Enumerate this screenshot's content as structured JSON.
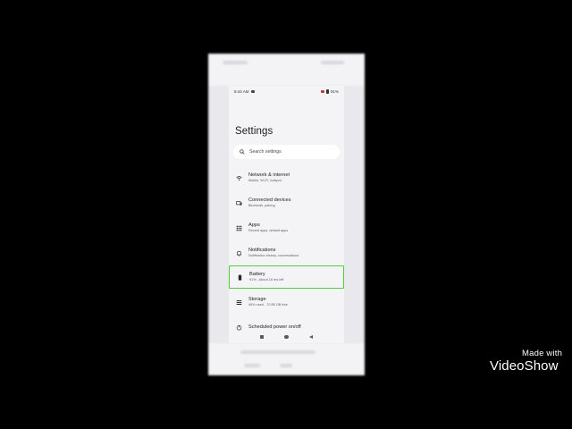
{
  "status_bar": {
    "time": "8:44 AM",
    "battery": "91%"
  },
  "page_title": "Settings",
  "search": {
    "placeholder": "Search settings"
  },
  "items": [
    {
      "title": "Network & internet",
      "subtitle": "Mobile, Wi-Fi, hotspot",
      "icon": "wifi-icon",
      "selected": false
    },
    {
      "title": "Connected devices",
      "subtitle": "Bluetooth, pairing",
      "icon": "connected-devices-icon",
      "selected": false
    },
    {
      "title": "Apps",
      "subtitle": "Recent apps, default apps",
      "icon": "apps-grid-icon",
      "selected": false
    },
    {
      "title": "Notifications",
      "subtitle": "Notification history, conversations",
      "icon": "bell-icon",
      "selected": false
    },
    {
      "title": "Battery",
      "subtitle": "91% - About 16 hrs left",
      "icon": "battery-icon",
      "selected": true
    },
    {
      "title": "Storage",
      "subtitle": "45% used - 70.85 GB free",
      "icon": "storage-icon",
      "selected": false
    },
    {
      "title": "Scheduled power on/off",
      "subtitle": "",
      "icon": "power-icon",
      "selected": false
    }
  ],
  "watermark": {
    "made_with": "Made with",
    "brand": "VideoShow"
  },
  "colors": {
    "highlight": "#4cd137",
    "background": "#f4f3f6"
  }
}
